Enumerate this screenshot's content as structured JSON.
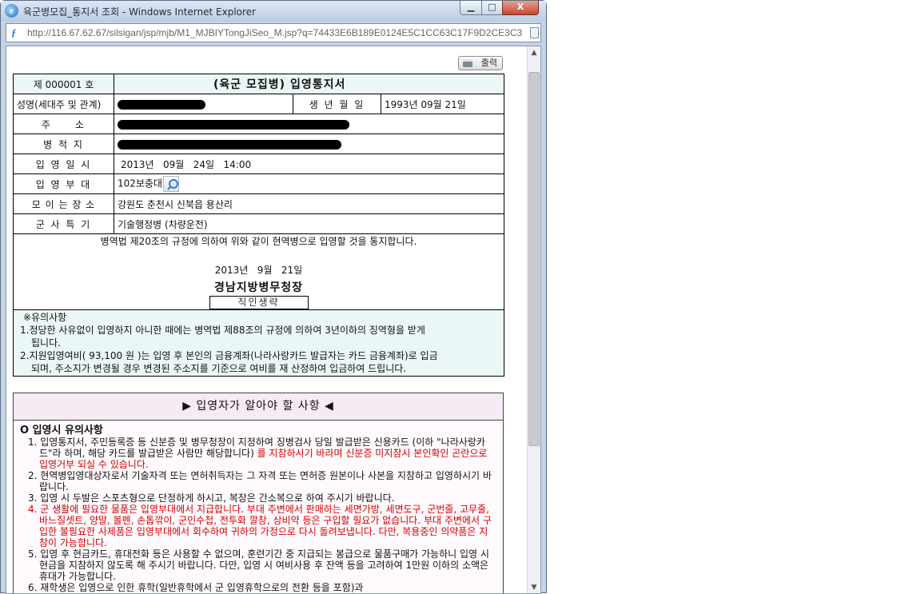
{
  "window": {
    "title": "육군병모집_통지서 조회 - Windows Internet Explorer",
    "url": "http://116.67.62.67/silsigan/jsp/mjb/M1_MJBIYTongJiSeo_M.jsp?q=74433E6B189E0124E5C1CC63C17F9D2CE3C3",
    "minimize_label": "▁",
    "maximize_label": "□",
    "close_label": "X",
    "page_icon": "ƒ"
  },
  "toolbar": {
    "print_label": "출력"
  },
  "notice": {
    "number": "제 000001 호",
    "title": "(육군 모집병) 입영통지서",
    "name_label": "성명(세대주 및 관계)",
    "birth_label": "생 년 월 일",
    "birth_value": "1993년 09월 21일",
    "address_label": "주     소",
    "domicile_label": "병 적 지",
    "enlist_date_label": "입 영 일 시",
    "enlist_date_value": "2013년   09월   24일   14:00",
    "unit_label": "입 영 부 대",
    "unit_value": "102보충대",
    "gathering_label": "모 이 는 장 소",
    "gathering_value": "강원도 춘천시 신북읍 용산리",
    "specialty_label": "군 사 특 기",
    "specialty_value": "기술행정병 (차량운전)",
    "body_text": "병역법 제20조의 규정에 의하여 위와 같이 현역병으로 입영할 것을 통지합니다.",
    "issue_date": "2013년   9월   21일",
    "issuer": "경남지방병무청장",
    "seal_label": "직인생략"
  },
  "caution": {
    "title": "※유의사항",
    "item1_a": "1.정당한 사유없이 입영하지 아니한 때에는 병역법 제88조의 규정에 의하여 3년이하의 징역형을 받게",
    "item1_b": "됩니다.",
    "item2_a": "2.지원입영여비( 93,100 원 )는 입영 후 본인의 금융계좌(나라사랑카드 발급자는 카드 금융계좌)로 입금",
    "item2_b": "되며, 주소지가 변경될 경우 변경된 주소지를 기준으로 여비를 재 산정하여 입금하여 드립니다."
  },
  "info": {
    "header": "▶ 입영자가 알아야 할 사항 ◀",
    "section_title": "O 입영시 유의사항",
    "i1_black": "1. 입영통지서, 주민등록증 등 신분증 및 병무청장이 지정하여 징병검사 당일 발급받은 신용카드 (이하 \"나라사랑카드\"라 하며, 해당 카드를 발급받은 사람만 해당합니다)",
    "i1_red": " 를 지참하시기 바라며 신분증 미지참시 본인확인 곤란으로 입영거부 되실 수 있습니다.",
    "i2": "2. 현역병입영대상자로서 기술자격 또는 면허취득자는 그 자격 또는 면허증 원본이나 사본을 지참하고 입영하시기 바랍니다.",
    "i3": "3. 입영 시 두발은 스포츠형으로 단정하게 하시고, 복장은 간소복으로 하여 주시기 바랍니다.",
    "i4": "4. 군 생활에 필요한 물품은 입영부대에서 지급합니다. 부대 주변에서 판매하는 세면가방, 세면도구, 군번줄, 고무줄, 바느질셋트, 양말, 볼펜, 손톱깎이, 군인수첩, 전투화 깔창, 상비약 등은 구입할 필요가 없습니다. 부대 주변에서 구입한 불필요한 사제품은 입영부대에서 회수하여 귀하의 가정으로 다시 돌려보냅니다. 다만, 복용중인 의약품은 지참이 가능합니다.",
    "i5": "5. 입영 후 현금카드, 휴대전화 등은 사용할 수 없으며, 훈련기간 중 지급되는 봉급으로 물품구매가 가능하니 입영 시 현금을 지참하지 않도록 해 주시기 바랍니다. 다만, 입영 시 여비사용 후 잔액 등을 고려하여 1만원 이하의 소액은 휴대가 가능합니다.",
    "i6": "6. 재학생은 입영으로 인한 휴학(일반휴학에서 군 입영휴학으로의 전환 등을 포함)과"
  },
  "colors": {
    "caution_bg": "#ebf6f6",
    "caution_text": "#00008b",
    "info_header_bg": "#f6eaf4",
    "warning_red": "#d40000"
  }
}
